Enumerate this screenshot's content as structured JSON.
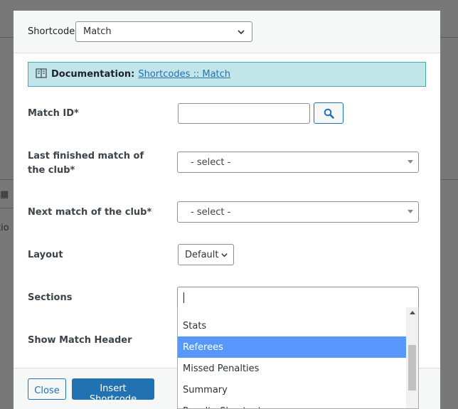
{
  "background": {
    "fragment_text": "tio"
  },
  "header": {
    "shortcode_label": "Shortcode",
    "shortcode_value": "Match"
  },
  "documentation": {
    "label": "Documentation:",
    "link_text": "Shortcodes :: Match",
    "icon": "book-icon"
  },
  "form": {
    "match_id": {
      "label": "Match ID*",
      "value": ""
    },
    "last_finished": {
      "label": "Last finished match of the club*",
      "value": "- select -"
    },
    "next_match": {
      "label": "Next match of the club*",
      "value": "- select -"
    },
    "layout": {
      "label": "Layout",
      "value": "Default"
    },
    "sections": {
      "label": "Sections",
      "value": ""
    },
    "show_match_header": {
      "label": "Show Match Header"
    }
  },
  "dropdown": {
    "options": [
      "Stats",
      "Referees",
      "Missed Penalties",
      "Summary",
      "Penalty Shootout"
    ],
    "highlighted": "Referees"
  },
  "footer": {
    "close_label": "Close",
    "insert_label": "Insert Shortcode"
  },
  "colors": {
    "accent": "#2271b1",
    "highlight": "#5897fb",
    "notice_bg": "#c2e5ea"
  }
}
